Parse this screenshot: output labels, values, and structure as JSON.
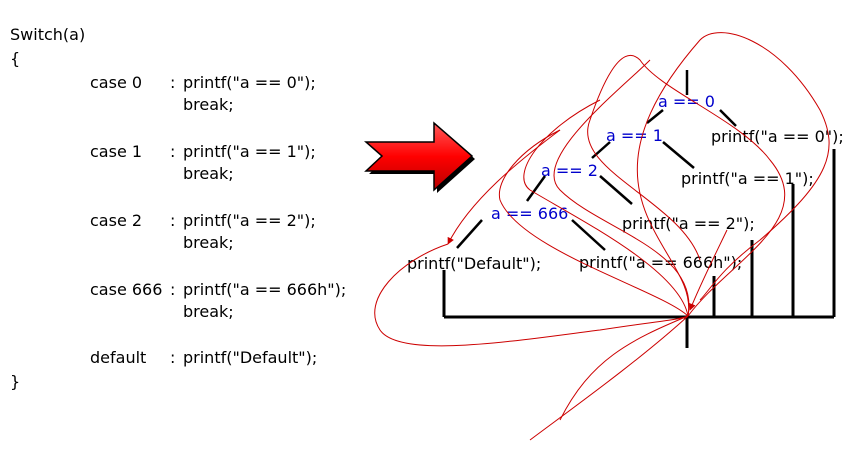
{
  "code": {
    "header": "Switch(a)",
    "open_brace": "{",
    "close_brace": "}",
    "cases": [
      {
        "label": "case 0",
        "sep": ": ",
        "action": "printf(\"a == 0\");",
        "brk": "break;"
      },
      {
        "label": "case 1",
        "sep": ": ",
        "action": "printf(\"a == 1\");",
        "brk": "break;"
      },
      {
        "label": "case 2",
        "sep": ": ",
        "action": "printf(\"a == 2\");",
        "brk": "break;"
      },
      {
        "label": "case 666",
        "sep": ": ",
        "action": "printf(\"a == 666h\");",
        "brk": "break;"
      },
      {
        "label": "default",
        "sep": ": ",
        "action": "printf(\"Default\");"
      }
    ]
  },
  "tree": {
    "conditions": [
      "a == 0",
      "a == 1",
      "a == 2",
      "a == 666"
    ],
    "actions": [
      "printf(\"a == 0\");",
      "printf(\"a == 1\");",
      "printf(\"a == 2\");",
      "printf(\"a == 666h\");",
      "printf(\"Default\");"
    ]
  },
  "colors": {
    "arrow": "#ff0000",
    "condition_text": "#0000cc",
    "path": "#cc0000",
    "lines": "#000000"
  }
}
